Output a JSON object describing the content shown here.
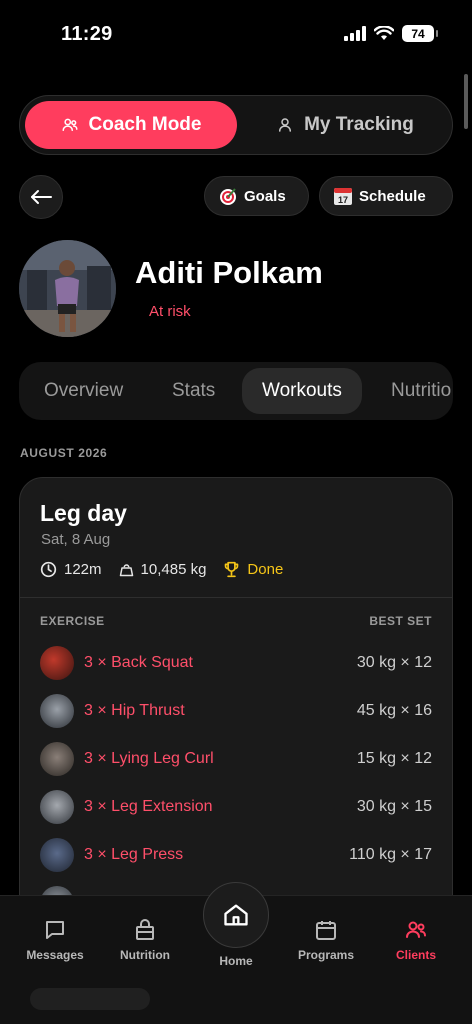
{
  "status_bar": {
    "time": "11:29",
    "battery": "74"
  },
  "mode_switch": {
    "coach": "Coach Mode",
    "tracking": "My Tracking"
  },
  "actions": {
    "goals": "Goals",
    "schedule": "Schedule"
  },
  "client": {
    "name": "Aditi Polkam",
    "status": "At risk"
  },
  "tabs": [
    "Overview",
    "Stats",
    "Workouts",
    "Nutritio"
  ],
  "active_tab": "Workouts",
  "month_label": "AUGUST 2026",
  "workout": {
    "title": "Leg day",
    "date": "Sat, 8 Aug",
    "duration": "122m",
    "volume": "10,485 kg",
    "status": "Done",
    "col_exercise": "EXERCISE",
    "col_best": "BEST SET",
    "exercises": [
      {
        "name": "3 × Back Squat",
        "best": "30 kg × 12"
      },
      {
        "name": "3 × Hip Thrust",
        "best": "45 kg × 16"
      },
      {
        "name": "3 × Lying Leg Curl",
        "best": "15 kg × 12"
      },
      {
        "name": "3 × Leg Extension",
        "best": "30 kg × 15"
      },
      {
        "name": "3 × Leg Press",
        "best": "110 kg × 17"
      }
    ]
  },
  "nav": {
    "messages": "Messages",
    "nutrition": "Nutrition",
    "home": "Home",
    "programs": "Programs",
    "clients": "Clients"
  },
  "colors": {
    "accent": "#ff3d5e",
    "done": "#f5c518",
    "risk": "#ff4f6a"
  }
}
